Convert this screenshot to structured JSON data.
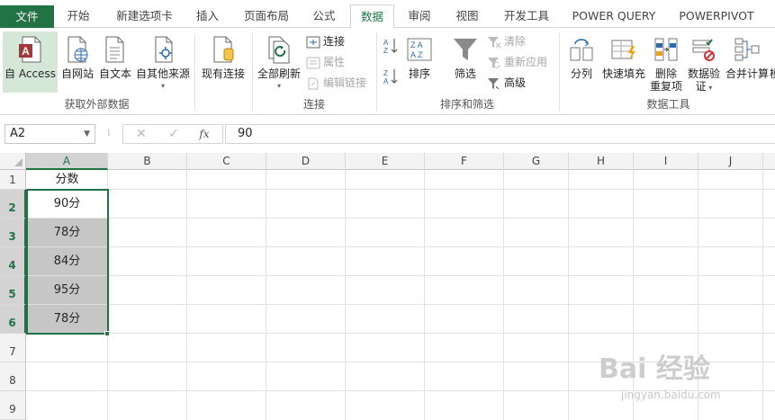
{
  "tabs": {
    "file": "文件",
    "home": "开始",
    "newtab": "新建选项卡",
    "insert": "插入",
    "layout": "页面布局",
    "formulas": "公式",
    "data": "数据",
    "review": "审阅",
    "view": "视图",
    "developer": "开发工具",
    "powerquery": "POWER QUERY",
    "powerpivot": "POWERPIVOT"
  },
  "ribbon": {
    "get_external": {
      "access": "自 Access",
      "web": "自网站",
      "text": "自文本",
      "other": "自其他来源",
      "group": "获取外部数据"
    },
    "existing": "现有连接",
    "connections": {
      "refresh_all": "全部刷新",
      "connections": "连接",
      "properties": "属性",
      "edit_links": "编辑链接",
      "group": "连接"
    },
    "sort_filter": {
      "sort": "排序",
      "filter": "筛选",
      "clear": "清除",
      "reapply": "重新应用",
      "advanced": "高级",
      "group": "排序和筛选"
    },
    "data_tools": {
      "split": "分列",
      "flash_fill": "快速填充",
      "remove_dup_1": "删除",
      "remove_dup_2": "重复项",
      "validation_1": "数据验",
      "validation_2": "证",
      "consolidate": "合并计算",
      "more": "模",
      "group": "数据工具"
    }
  },
  "formula_bar": {
    "name_box": "A2",
    "fx": "fx",
    "value": "90"
  },
  "columns": [
    "A",
    "B",
    "C",
    "D",
    "E",
    "F",
    "G",
    "H",
    "I",
    "J"
  ],
  "rows": [
    "1",
    "2",
    "3",
    "4",
    "5",
    "6",
    "7",
    "8",
    "9"
  ],
  "cells": {
    "A1": "分数",
    "A2": "90分",
    "A3": "78分",
    "A4": "84分",
    "A5": "95分",
    "A6": "78分"
  },
  "watermark": {
    "brand": "Bai 经验",
    "url": "jingyan.baidu.com"
  },
  "colors": {
    "accent": "#217346",
    "selected_fill": "#c6c6c6"
  }
}
